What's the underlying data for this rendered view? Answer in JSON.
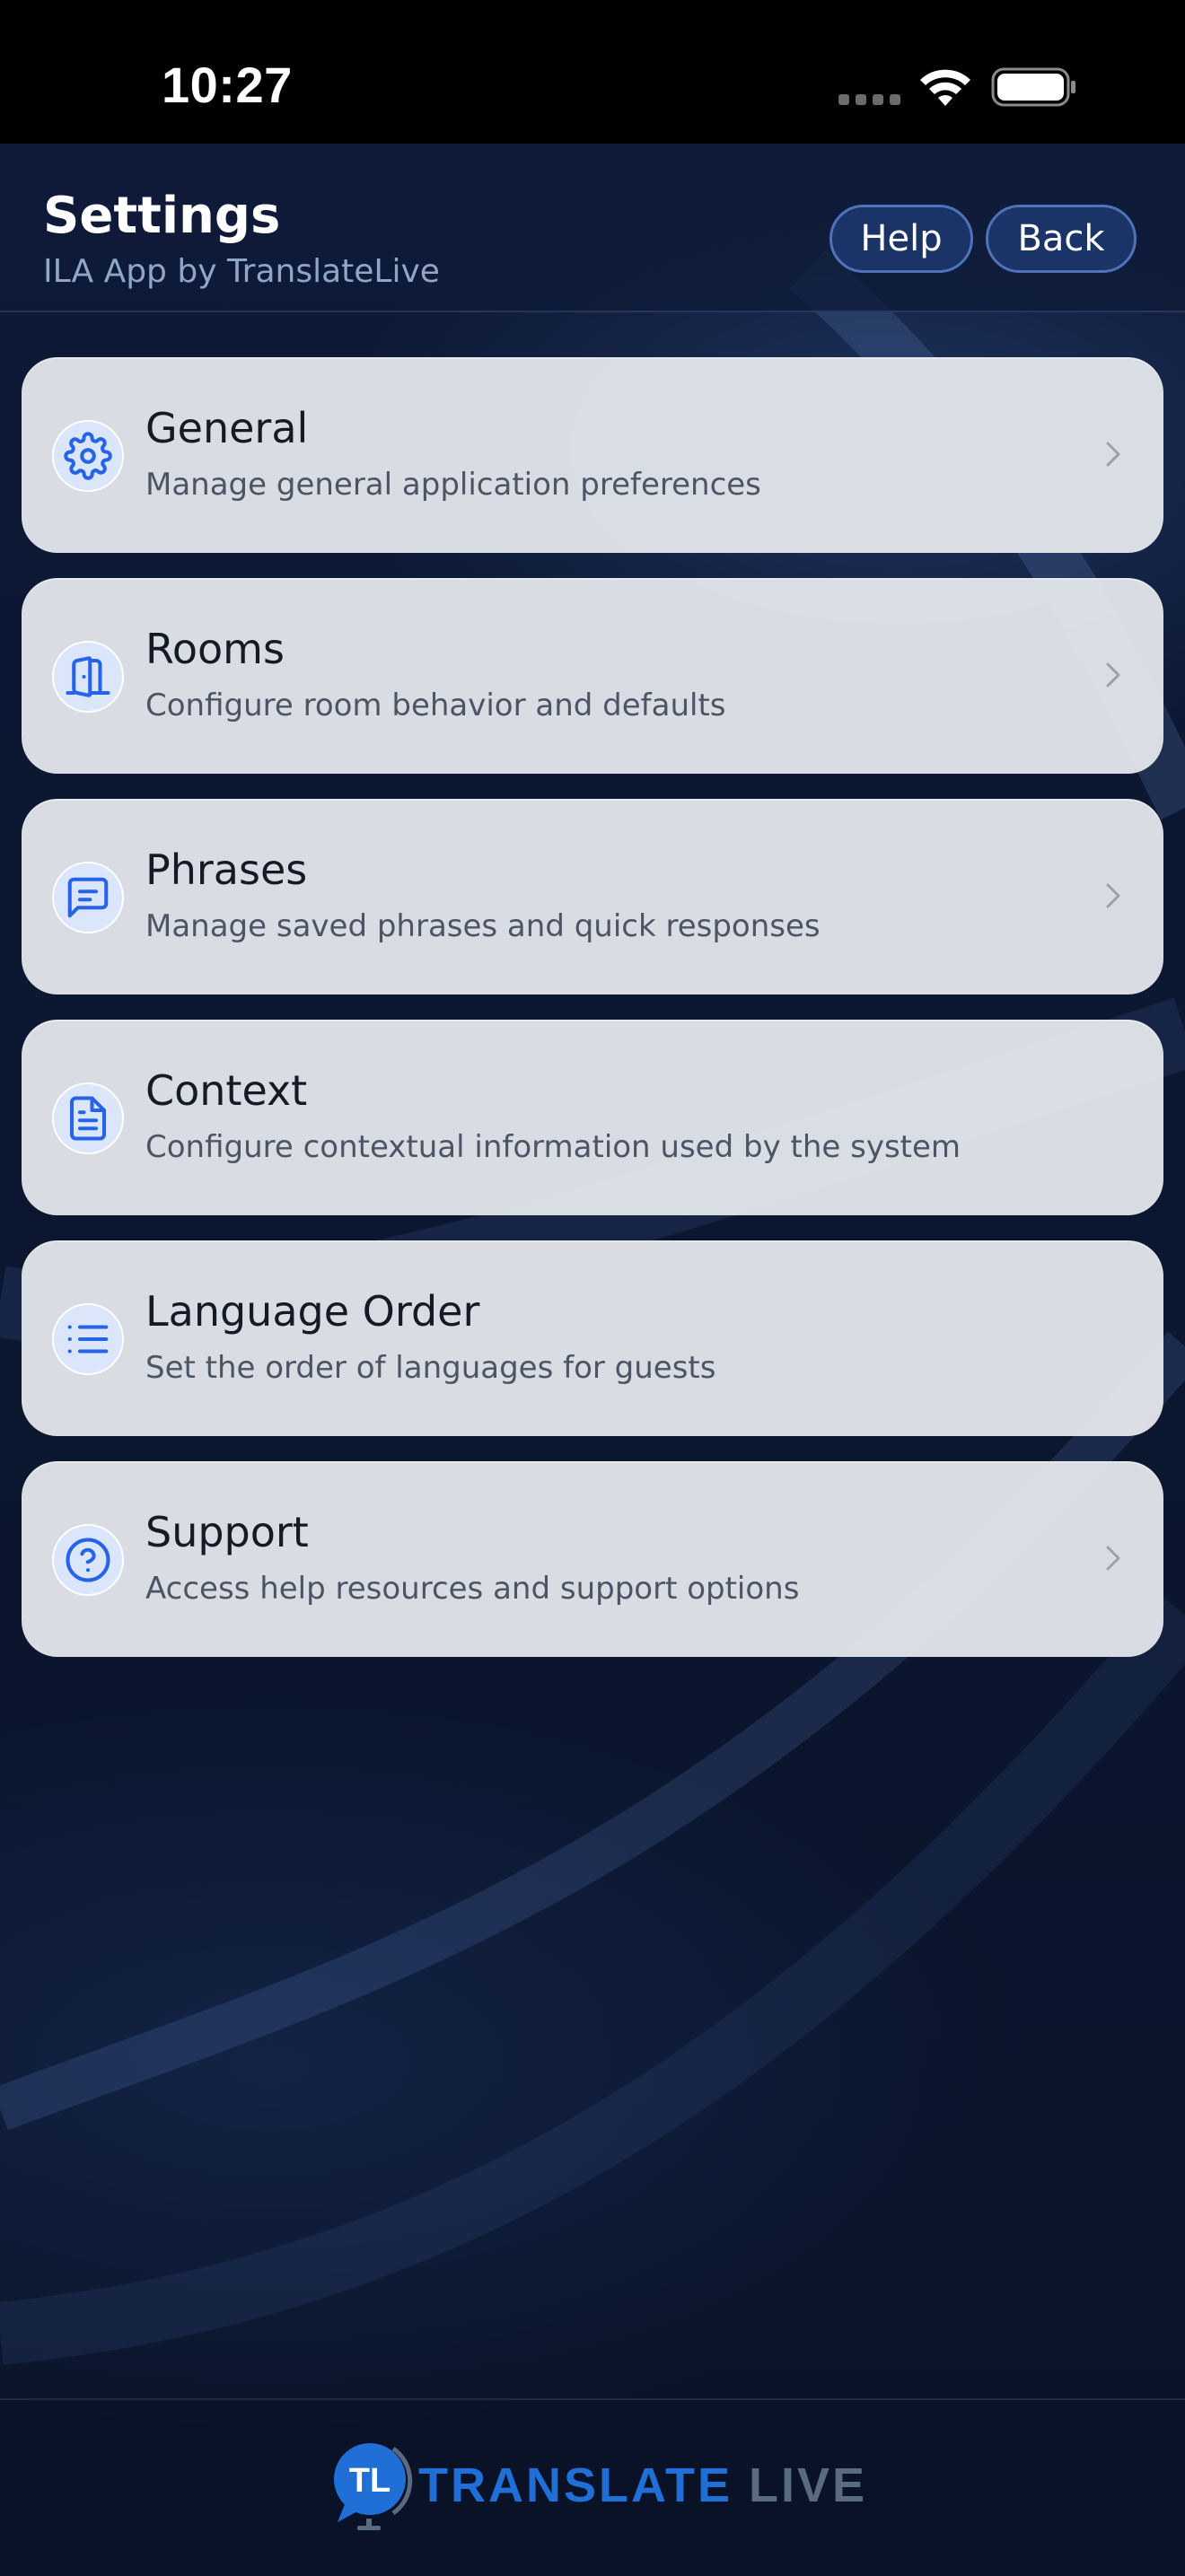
{
  "status_bar": {
    "time": "10:27"
  },
  "header": {
    "title": "Settings",
    "subtitle": "ILA App by TranslateLive",
    "help_label": "Help",
    "back_label": "Back"
  },
  "settings": [
    {
      "title": "General",
      "description": "Manage general application preferences",
      "icon": "gear-icon",
      "chevron": true
    },
    {
      "title": "Rooms",
      "description": "Configure room behavior and defaults",
      "icon": "door-icon",
      "chevron": true
    },
    {
      "title": "Phrases",
      "description": "Manage saved phrases and quick responses",
      "icon": "message-icon",
      "chevron": true
    },
    {
      "title": "Context",
      "description": "Configure contextual information used by the system",
      "icon": "document-icon",
      "chevron": false
    },
    {
      "title": "Language Order",
      "description": "Set the order of languages for guests",
      "icon": "list-icon",
      "chevron": false
    },
    {
      "title": "Support",
      "description": "Access help resources and support options",
      "icon": "help-circle-icon",
      "chevron": true
    }
  ],
  "footer": {
    "logo_word1": "TRANSLATE",
    "logo_word2": "LIVE",
    "logo_mark": "TL"
  },
  "colors": {
    "accent": "#1f6fd6",
    "icon_blue": "#2563eb",
    "card_bg": "#e2e5ea",
    "header_button": "#1a3468"
  }
}
